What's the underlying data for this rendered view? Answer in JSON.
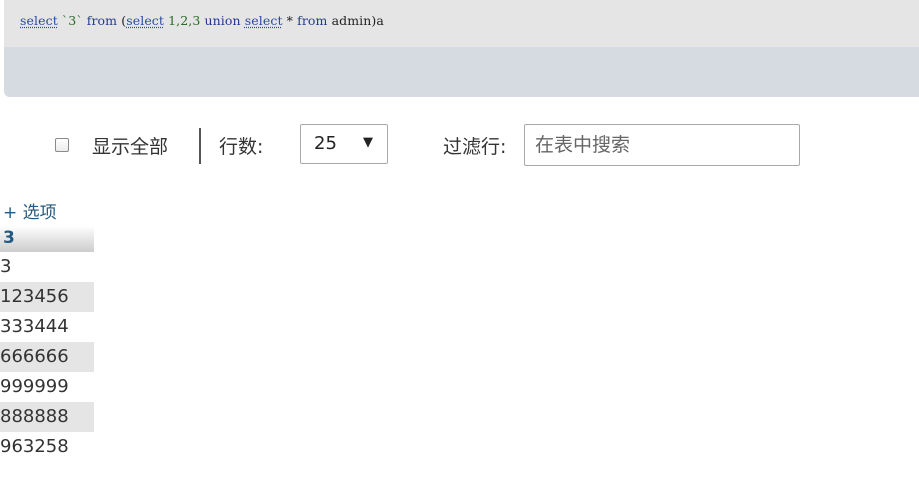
{
  "sql": {
    "tokens": [
      {
        "text": "select",
        "type": "kw-link"
      },
      {
        "text": " `3` ",
        "type": "lit"
      },
      {
        "text": "from",
        "type": "kw"
      },
      {
        "text": " (",
        "type": "plain"
      },
      {
        "text": "select",
        "type": "kw-link"
      },
      {
        "text": " 1,2,3 ",
        "type": "num"
      },
      {
        "text": "union",
        "type": "kw"
      },
      {
        "text": " ",
        "type": "plain"
      },
      {
        "text": "select",
        "type": "kw-link"
      },
      {
        "text": " * ",
        "type": "plain"
      },
      {
        "text": "from",
        "type": "kw"
      },
      {
        "text": " admin)a",
        "type": "plain"
      }
    ]
  },
  "controls": {
    "show_all_label": "显示全部",
    "show_all_checked": false,
    "rows_label": "行数:",
    "rows_value": "25",
    "rows_arrow": "▼",
    "filter_label": "过滤行:",
    "filter_placeholder": "在表中搜索",
    "filter_value": ""
  },
  "results": {
    "options_link": "+ 选项",
    "column_header": "3",
    "rows": [
      "3",
      "123456",
      "333444",
      "666666",
      "999999",
      "888888",
      "963258"
    ]
  },
  "colors": {
    "sql_panel_bg": "#e5e5e5",
    "sql_toolbar_bg": "#d5dbe1",
    "link": "#235a81",
    "row_alt": "#e5e5e5"
  }
}
